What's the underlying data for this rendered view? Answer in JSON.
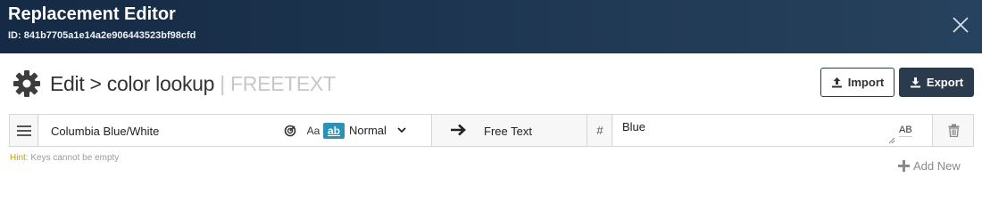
{
  "header": {
    "title": "Replacement Editor",
    "id_text": "ID: 841b7705a1e14a2e906443523bf98cfd"
  },
  "page": {
    "title": "Edit > color lookup",
    "mode_separator": " | ",
    "mode": "FREETEXT"
  },
  "toolbar": {
    "import_label": "Import",
    "export_label": "Export"
  },
  "rows": [
    {
      "key": "Columbia Blue/White",
      "case_option": "Aa",
      "word_option": "ab",
      "match_mode": "Normal",
      "target_type": "Free Text",
      "hash": "#",
      "value": "Blue",
      "value_format": "AB"
    }
  ],
  "hint": {
    "label": "Hint",
    "text": ": Keys cannot be empty"
  },
  "add_new_label": "Add New",
  "colors": {
    "header_start": "#152a44",
    "header_end": "#27425e",
    "accent": "#2a92b4",
    "export_bg": "#2b3b4e",
    "hint_label": "#c4a000"
  },
  "icons": {
    "close": "close-icon",
    "settings": "gear-icon",
    "import": "upload-icon",
    "export": "download-icon",
    "drag": "hamburger-icon",
    "regex": "regex-icon",
    "mode_dropdown": "chevron-down-icon",
    "arrow": "arrow-right-icon",
    "delete": "trash-icon",
    "add": "plus-icon"
  }
}
